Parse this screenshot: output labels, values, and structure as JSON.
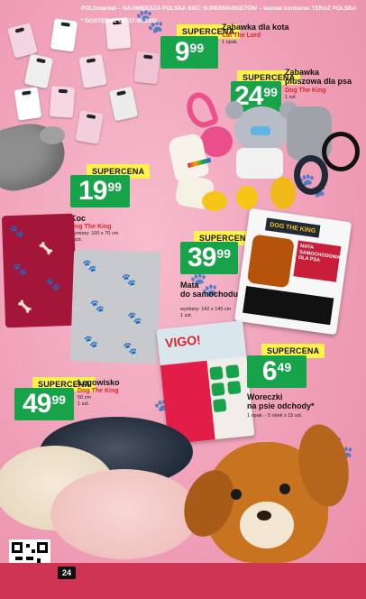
{
  "page": {
    "number": "24",
    "footer_text": "POLOmarket – NAJWIĘKSZA POLSKA SIEĆ SUPERMARKETÓW – laureat konkursu TERAZ POLSKA",
    "footer_note": "* DOSTĘPNE OD 17.06.2025"
  },
  "products": [
    {
      "tag": "SUPERCENA",
      "price_int": "9",
      "price_dec": "99",
      "name_lines": [
        "Zabawka dla kota"
      ],
      "brand": "Cat The Lord",
      "meta": [
        "1 opak."
      ]
    },
    {
      "tag": "SUPERCENA",
      "price_int": "24",
      "price_dec": "99",
      "name_lines": [
        "Zabawka",
        "pluszowa dla psa"
      ],
      "brand": "Dog The King",
      "meta": [
        "1 szt."
      ]
    },
    {
      "tag": "SUPERCENA",
      "price_int": "19",
      "price_dec": "99",
      "name_lines": [
        "Koc"
      ],
      "brand": "Dog The King",
      "meta": [
        "wymiary: 100 x 70 cm",
        "1 szt."
      ]
    },
    {
      "tag": "SUPERCENA",
      "price_int": "39",
      "price_dec": "99",
      "name_lines": [
        "Mata",
        "do samochodu"
      ],
      "brand": "",
      "meta": [
        "wymiary: 142 x 145 cm",
        "1 szt."
      ]
    },
    {
      "tag": "SUPERCENA",
      "price_int": "6",
      "price_dec": "49",
      "name_lines": [
        "Woreczki",
        "na psie odchody*"
      ],
      "brand": "",
      "meta": [
        "1 opak. - 5 rolek x 15 szt."
      ]
    },
    {
      "tag": "SUPERCENA",
      "price_int": "49",
      "price_dec": "99",
      "name_lines": [
        "Legowisko"
      ],
      "brand": "Dog The King",
      "meta": [
        "50 cm",
        "1 szt."
      ]
    }
  ],
  "packaging": {
    "mat_brand": "DOG THE KING",
    "mat_label": "MATA SAMOCHODOWA DLA PSA",
    "bags_brand": "VIGO!"
  },
  "colors": {
    "price_green": "#16a34a",
    "tag_yellow": "#fff34a",
    "brand_red": "#dc2626",
    "footer_red": "#cf3553"
  }
}
